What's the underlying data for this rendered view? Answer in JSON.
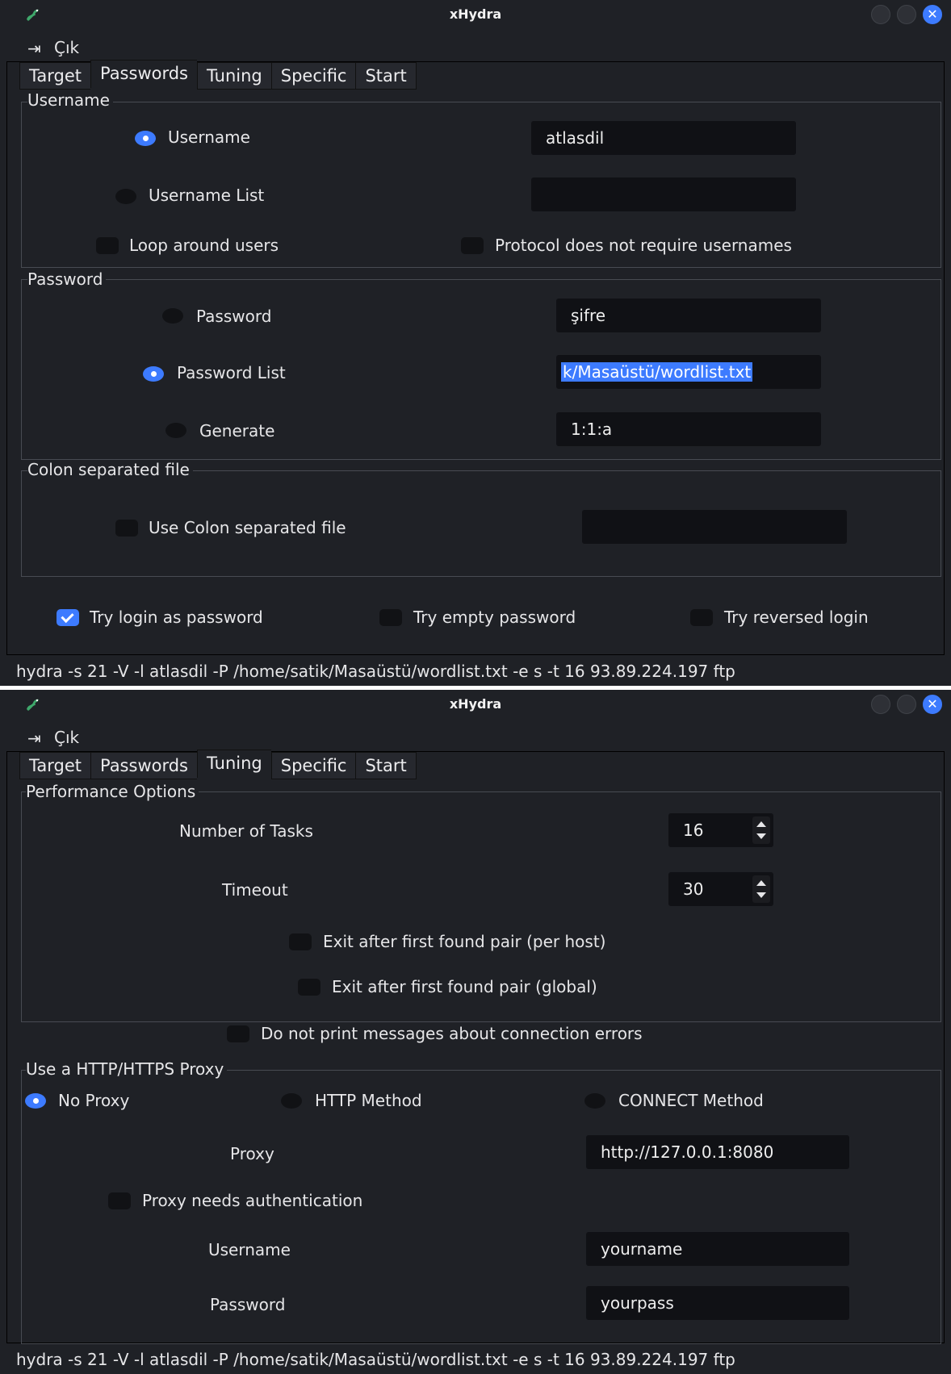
{
  "window_title": "xHydra",
  "menu": {
    "quit_label": "Çık"
  },
  "tabs": [
    "Target",
    "Passwords",
    "Tuning",
    "Specific",
    "Start"
  ],
  "command_line": "hydra -s 21 -V -l atlasdil -P /home/satik/Masaüstü/wordlist.txt -e s -t 16 93.89.224.197 ftp",
  "passwords_tab": {
    "username_group": {
      "title": "Username",
      "username_radio": "Username",
      "username_value": "atlasdil",
      "username_list_radio": "Username List",
      "username_list_value": "",
      "loop_users": "Loop around users",
      "no_usernames": "Protocol does not require usernames"
    },
    "password_group": {
      "title": "Password",
      "password_radio": "Password",
      "password_value": "şifre",
      "password_list_radio": "Password List",
      "password_list_value": "k/Masaüstü/wordlist.txt",
      "generate_radio": "Generate",
      "generate_value": "1:1:a"
    },
    "colon_group": {
      "title": "Colon separated file",
      "use_colon": "Use Colon separated file",
      "colon_value": ""
    },
    "try_login": "Try login as password",
    "try_empty": "Try empty password",
    "try_reversed": "Try reversed login"
  },
  "tuning_tab": {
    "performance_group": {
      "title": "Performance Options",
      "tasks_label": "Number of Tasks",
      "tasks_value": "16",
      "timeout_label": "Timeout",
      "timeout_value": "30",
      "exit_per_host": "Exit after first found pair (per host)",
      "exit_global": "Exit after first found pair (global)",
      "no_conn_errors": "Do not print messages about connection errors"
    },
    "proxy_group": {
      "title": "Use a HTTP/HTTPS Proxy",
      "no_proxy": "No Proxy",
      "http_method": "HTTP Method",
      "connect_method": "CONNECT Method",
      "proxy_label": "Proxy",
      "proxy_value": "http://127.0.0.1:8080",
      "needs_auth": "Proxy needs authentication",
      "username_label": "Username",
      "username_value": "yourname",
      "password_label": "Password",
      "password_value": "yourpass"
    }
  },
  "colors": {
    "accent": "#3d7bff",
    "window_bg": "#1f2126",
    "field_bg": "#101115",
    "text": "#e6e6e8"
  }
}
